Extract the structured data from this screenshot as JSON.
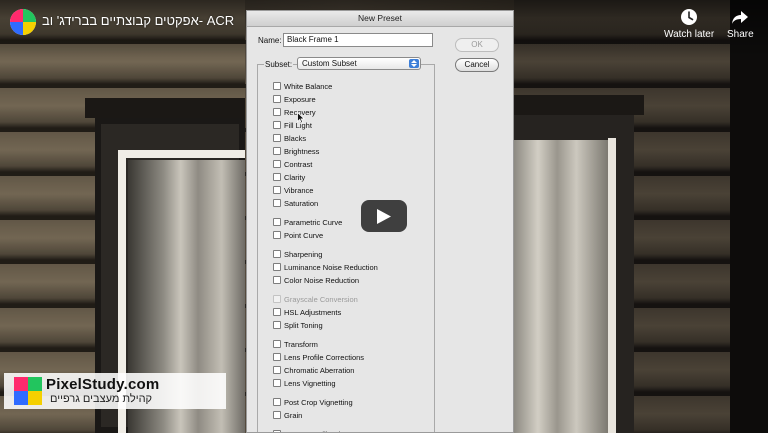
{
  "youtube": {
    "video_title": "אפקטים קבוצתיים בברידג' וב- ACR",
    "watch_later_label": "Watch later",
    "share_label": "Share",
    "avatar_icon": "channel-logo-icon",
    "play_icon": "play-icon"
  },
  "watermark": {
    "name": "PixelStudy.com",
    "subtitle": "קהילת מעצבים גרפיים"
  },
  "dialog": {
    "title": "New Preset",
    "name_label": "Name:",
    "name_value": "Black Frame 1",
    "ok_label": "OK",
    "cancel_label": "Cancel",
    "subset_label": "Subset:",
    "subset_value": "Custom Subset",
    "options": [
      {
        "label": "White Balance",
        "checked": false,
        "enabled": true
      },
      {
        "label": "Exposure",
        "checked": false,
        "enabled": true
      },
      {
        "label": "Recovery",
        "checked": false,
        "enabled": true
      },
      {
        "label": "Fill Light",
        "checked": false,
        "enabled": true
      },
      {
        "label": "Blacks",
        "checked": false,
        "enabled": true
      },
      {
        "label": "Brightness",
        "checked": false,
        "enabled": true
      },
      {
        "label": "Contrast",
        "checked": false,
        "enabled": true
      },
      {
        "label": "Clarity",
        "checked": false,
        "enabled": true
      },
      {
        "label": "Vibrance",
        "checked": false,
        "enabled": true
      },
      {
        "label": "Saturation",
        "checked": false,
        "enabled": true
      },
      {
        "label": "Parametric Curve",
        "checked": false,
        "enabled": true
      },
      {
        "label": "Point Curve",
        "checked": false,
        "enabled": true
      },
      {
        "label": "Sharpening",
        "checked": false,
        "enabled": true
      },
      {
        "label": "Luminance Noise Reduction",
        "checked": false,
        "enabled": true
      },
      {
        "label": "Color Noise Reduction",
        "checked": false,
        "enabled": true
      },
      {
        "label": "Grayscale Conversion",
        "checked": false,
        "enabled": false
      },
      {
        "label": "HSL Adjustments",
        "checked": false,
        "enabled": true
      },
      {
        "label": "Split Toning",
        "checked": false,
        "enabled": true
      },
      {
        "label": "Transform",
        "checked": false,
        "enabled": true
      },
      {
        "label": "Lens Profile Corrections",
        "checked": false,
        "enabled": true
      },
      {
        "label": "Chromatic Aberration",
        "checked": false,
        "enabled": true
      },
      {
        "label": "Lens Vignetting",
        "checked": false,
        "enabled": true
      },
      {
        "label": "Post Crop Vignetting",
        "checked": false,
        "enabled": true
      },
      {
        "label": "Grain",
        "checked": false,
        "enabled": true
      },
      {
        "label": "Camera Calibration",
        "checked": false,
        "enabled": true
      }
    ]
  },
  "colors": {
    "accent": "#3d7fd8",
    "play_button": "#212121",
    "disabled_text": "#9b9b9b"
  }
}
